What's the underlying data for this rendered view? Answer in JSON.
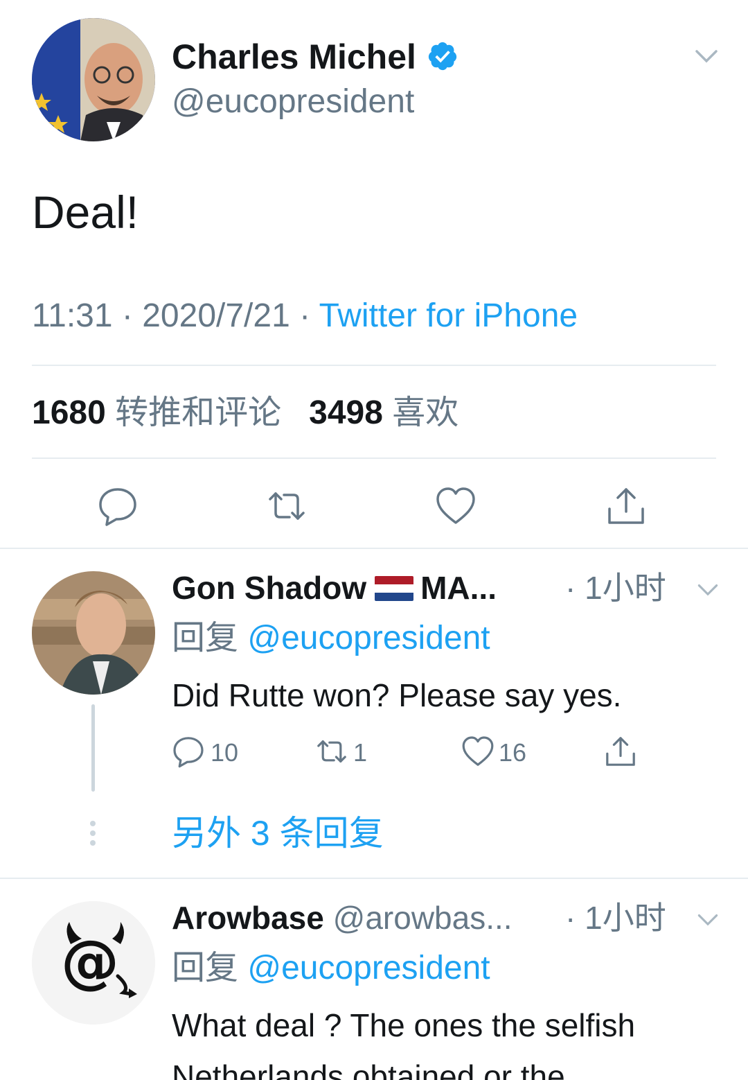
{
  "main_tweet": {
    "name": "Charles Michel",
    "handle": "@eucopresident",
    "text": "Deal!",
    "time": "11:31",
    "date": "2020/7/21",
    "source": "Twitter for iPhone",
    "retweets_count": "1680",
    "retweets_label": "转推和评论",
    "likes_count": "3498",
    "likes_label": "喜欢"
  },
  "replies": [
    {
      "name": "Gon Shadow",
      "name_suffix": "MA...",
      "time": "1小时",
      "reply_prefix": "回复",
      "reply_to": "@eucopresident",
      "text": "Did Rutte won? Please say yes.",
      "reply_count": "10",
      "retweet_count": "1",
      "like_count": "16",
      "more_replies": "另外 3 条回复"
    },
    {
      "name": "Arowbase",
      "handle": "@arowbas...",
      "time": "1小时",
      "reply_prefix": "回复",
      "reply_to": "@eucopresident",
      "text": "What deal ? The ones the selfish Netherlands obtained or the"
    }
  ],
  "colors": {
    "accent": "#1da1f2",
    "muted": "#657786",
    "divider": "#e6ecf0"
  }
}
